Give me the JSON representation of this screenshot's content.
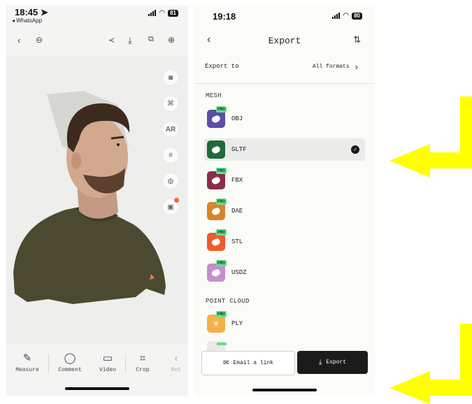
{
  "left_phone": {
    "status": {
      "time": "18:45 ➤",
      "back_app": "◂ WhatsApp",
      "battery": "81"
    },
    "toolbar_icons": [
      "back-arrow-icon",
      "more-icon",
      "share-icon",
      "download-icon",
      "aspect-icon",
      "globe-icon"
    ],
    "side_controls": {
      "ar_label": "AR"
    },
    "tools": [
      {
        "icon": "✎",
        "label": "Measure"
      },
      {
        "icon": "◯",
        "label": "Comment"
      },
      {
        "icon": "▭",
        "label": "Video"
      },
      {
        "icon": "⌗",
        "label": "Crop"
      },
      {
        "icon": "‹",
        "label": "Rot"
      }
    ]
  },
  "right_phone": {
    "status": {
      "time": "19:18",
      "battery": "80"
    },
    "header": {
      "back": "‹",
      "title": "Export",
      "sort_icon": "⇅"
    },
    "export_to": {
      "label": "Export to",
      "value": "All formats",
      "chevron": "›"
    },
    "mesh_section": "MESH",
    "mesh_formats": [
      {
        "label": "OBJ",
        "pro": "PRO",
        "color": "#5b4ea8"
      },
      {
        "label": "GLTF",
        "pro": "",
        "color": "#1e6b3d",
        "selected": true
      },
      {
        "label": "FBX",
        "pro": "PRO",
        "color": "#8a2d48"
      },
      {
        "label": "DAE",
        "pro": "PRO",
        "color": "#d9832a"
      },
      {
        "label": "STL",
        "pro": "PRO",
        "color": "#ee5b2d"
      },
      {
        "label": "USDZ",
        "pro": "PRO",
        "color": "#c58fcb"
      }
    ],
    "point_cloud_section": "POINT CLOUD",
    "point_cloud_formats": [
      {
        "label": "PLY",
        "pro": "PRO",
        "color": "#f3b14a"
      }
    ],
    "buttons": {
      "email": "Email a link",
      "export": "Export"
    }
  },
  "colors": {
    "arrow": "#ffff00",
    "pro_badge": "#5fe08a"
  }
}
